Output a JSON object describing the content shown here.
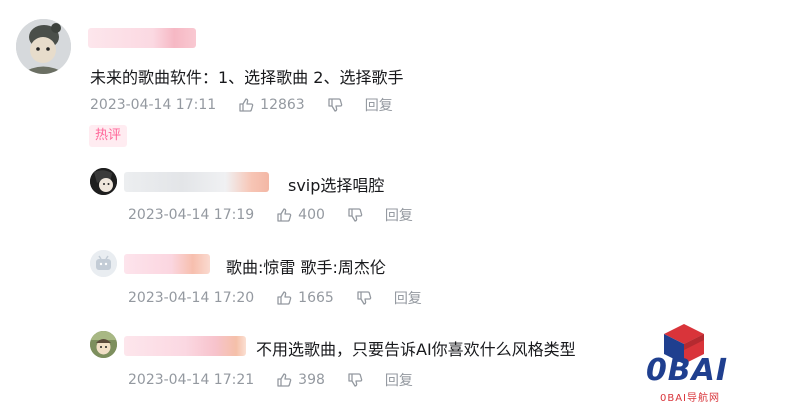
{
  "main_comment": {
    "text": "未来的歌曲软件：1、选择歌曲 2、选择歌手",
    "time": "2023-04-14 17:11",
    "likes": "12863",
    "reply_label": "回复",
    "tag": "热评"
  },
  "replies": [
    {
      "text": "svip选择唱腔",
      "time": "2023-04-14 17:19",
      "likes": "400",
      "reply_label": "回复"
    },
    {
      "text": "歌曲:惊雷 歌手:周杰伦",
      "time": "2023-04-14 17:20",
      "likes": "1665",
      "reply_label": "回复"
    },
    {
      "text": "不用选歌曲，只要告诉AI你喜欢什么风格类型",
      "time": "2023-04-14 17:21",
      "likes": "398",
      "reply_label": "回复"
    }
  ],
  "watermark": {
    "brand": "0BAI",
    "subtitle": "0BAI导航网",
    "colors": {
      "red": "#d9343a",
      "navy": "#1f3f8f"
    }
  },
  "colors": {
    "meta_gray": "#9499a0",
    "text": "#18191c",
    "tag_pink": "#ff6699",
    "tag_bg": "#ffecf1"
  }
}
